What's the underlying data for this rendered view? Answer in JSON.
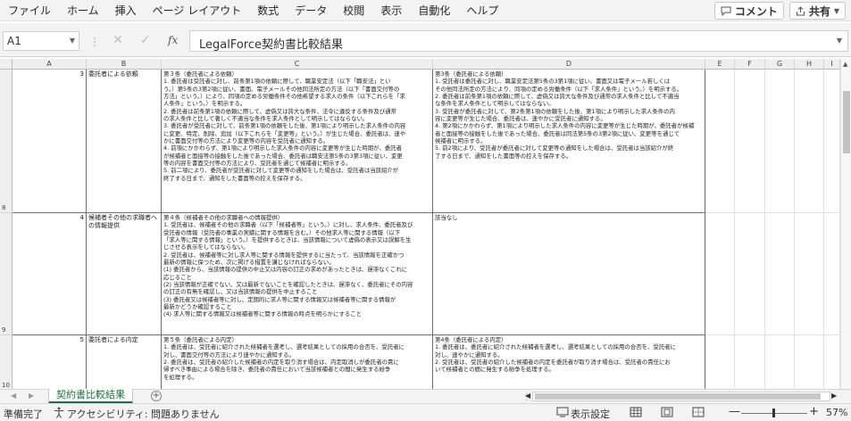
{
  "ribbon": {
    "tabs": [
      "ファイル",
      "ホーム",
      "挿入",
      "ページ レイアウト",
      "数式",
      "データ",
      "校閲",
      "表示",
      "自動化",
      "ヘルプ"
    ],
    "comment_button": "コメント",
    "share_button": "共有"
  },
  "formula_bar": {
    "name_box": "A1",
    "fx": "fx",
    "content": "LegalForce契約書比較結果"
  },
  "columns": [
    "A",
    "B",
    "C",
    "D",
    "E",
    "F",
    "G",
    "H",
    "I"
  ],
  "rows": [
    {
      "number": "8",
      "index": "3",
      "title": "委託者による依頼",
      "left_lines": [
        "第３条（委託者による依頼）",
        "1. 委託者は受託者に対し、前条第1項の依頼に際して、職業安定法（以下「職安法」とい",
        "う。）第5条の3第2項に従い、書面、電子メールその他同法所定の方法（以下「書面交付等の",
        "方法」という。）により、同項の定める労働条件その他希望する求人の条件（以下これらを「求",
        "人条件」という。）を明示する。",
        "2. 委託者は前条第1項の依頼に際して、虚偽又は誇大な条件、法令に違反する条件及び通常",
        "の求人条件と比して著しく不適当な条件を求人条件として明示してはならない。",
        "3. 委託者が受託者に対して、前条第1項の依頼をした後、第1項により明示した求人条件の内容",
        "に変更、特定、削除、追加（以下これらを「変更等」という。）が生じた場合、委託者は、速や",
        "かに書面交付等の方法により変更等の内容を受託者に通知する。",
        "4. 前項にかかわらず、第1項により明示した求人条件の内容に変更等が生じた時期が、委託者",
        "が候補者と面接等の接触をした後であった場合、委託者は職安法第5条の3第3項に従い、変更",
        "等の内容を書面交付等の方法により、受託者を通じて候補者に明示する。",
        "5. 前二項により、委託者が受託者に対して変更等の通知をした場合は、受託者は当該紹介が",
        "終了する日まで、通知をした書面等の控えを保存する。"
      ],
      "right_lines": [
        "第3条（委託者による依頼）",
        "1. 受託者は委託者に対し、職業安定法第5条の3第1項に従い、書面又は電子メール若しくは",
        "その他同法所定の方法により、同項の定める労働条件（以下「求人条件」という。）を明示する。",
        "2. 委託者は前条第1項の依頼に際して、虚偽又は誇大な条件及び通常の求人条件と比して不適当",
        "な条件を求人条件として明示してはならない。",
        "3. 受託者が委託者に対して、第2条第1項の依頼をした後、第1項により明示した求人条件の内",
        "容に変更等が生じた場合、委託者は、速やかに受託者に通知する。",
        "4. 第2項にかかわらず、第1項により明示した求人条件の内容に変更等が生じた時期が、委託者が候補",
        "者と面接等の接触をした後であった場合、委託者は同法第5条の3第2項に従い、変更等を通じて",
        "候補者に明示する。",
        "5. 前2項により、受託者が委託者に対して変更等の通知をした場合は、受託者は当該紹介が終",
        "了する日まで、通知をした書面等の控えを保存する。"
      ]
    },
    {
      "number": "9",
      "index": "4",
      "title": "候補者その他の求職者への情報提供",
      "left_lines": [
        "第４条（候補者その他の求職者への情報提供）",
        "1. 受託者は、候補者その他の求職者（以下「候補者等」という。）に対し、求人条件、委託者及び",
        "受託者の情報（受託者の事業の実績に関する情報を含む。）その他求人等に関する情報（以下",
        "「求人等に関する情報」という。）を提供するときは、当該情報について虚偽の表示又は誤解を生",
        "じさせる表示をしてはならない。",
        "2. 受託者は、候補者等に対し求人等に関する情報を提供するに当たって、当該情報を正確かつ",
        "最新の情報に保つため、次に掲げる措置を講じなければならない。",
        "(1) 委託者から、当該情報の提供の中止又は内容の訂正の求めがあったときは、遅滞なくこれに",
        "応じること",
        "(2) 当該情報が正確でない、又は最新でないことを確認したときは、遅滞なく、委託者にその内容",
        "の訂正の有無を確認し、又は当該情報の提供を中止すること",
        "(3) 委託者又は候補者等に対し、定期的に求人等に関する情報又は候補者等に関する情報が",
        "最新かどうか確認すること",
        "(4) 求人等に関する情報又は候補者等に関する情報の時点を明らかにすること"
      ],
      "right_lines": [
        "該当なし"
      ]
    },
    {
      "number": "10",
      "index": "5",
      "title": "委託者による内定",
      "left_lines": [
        "第５条（委託者による内定）",
        "1. 委託者は、受託者に紹介された候補者を選考し、選考結果としての採用の合否を、受託者に",
        "対し、書面交付等の方法により速やかに通知する。",
        "2. 委託者は、受託者の紹介した候補者の内定を取り消す場合は、内定取消しが委託者の責に",
        "帰すべき事由による場合を除き、委託者の責任において当該候補者との間に発生する紛争",
        "を処理する。"
      ],
      "right_lines": [
        "第4条（委託者による内定）",
        "1. 委託者は、委託者に紹介された候補者を選考し、選考結果としての採用の合否を、受託者に",
        "対し、速やかに通知する。",
        "2. 受託者は、受託者の紹介した候補者の内定を委託者が取り消す場合は、受託者の責任にお",
        "いて候補者との間に発生する紛争を処理する。"
      ]
    }
  ],
  "sheet_tab": "契約書比較結果",
  "status": {
    "ready": "準備完了",
    "accessibility": "アクセシビリティ: 問題ありません",
    "display_settings": "表示設定",
    "zoom": "57%"
  }
}
